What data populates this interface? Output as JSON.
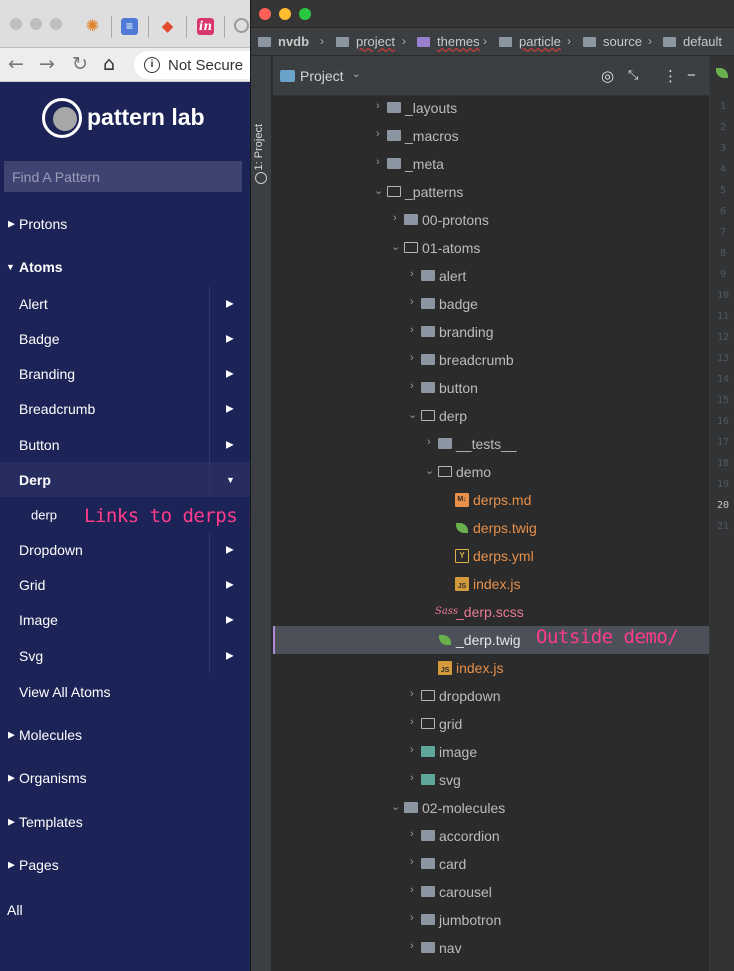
{
  "browser": {
    "address_text": "Not Secure",
    "logo_text": "pattern lab",
    "search_placeholder": "Find A Pattern",
    "nav": {
      "protons": "Protons",
      "atoms": "Atoms",
      "atoms_items": [
        "Alert",
        "Badge",
        "Branding",
        "Breadcrumb",
        "Button",
        "Derp",
        "derp",
        "Dropdown",
        "Grid",
        "Image",
        "Svg"
      ],
      "view_all": "View All Atoms",
      "molecules": "Molecules",
      "organisms": "Organisms",
      "templates": "Templates",
      "pages": "Pages",
      "all": "All"
    },
    "annotation_derp": "Links to derps page"
  },
  "ide": {
    "breadcrumbs": [
      "nvdb",
      "project",
      "themes",
      "particle",
      "source",
      "default"
    ],
    "side_tab": "1: Project",
    "project_title": "Project",
    "tree": [
      "_layouts",
      "_macros",
      "_meta",
      "_patterns",
      "00-protons",
      "01-atoms",
      "alert",
      "badge",
      "branding",
      "breadcrumb",
      "button",
      "derp",
      "__tests__",
      "demo",
      "derps.md",
      "derps.twig",
      "derps.yml",
      "index.js",
      "_derp.scss",
      "_derp.twig",
      "index.js",
      "dropdown",
      "grid",
      "image",
      "svg",
      "02-molecules",
      "accordion",
      "card",
      "carousel",
      "jumbotron",
      "nav"
    ],
    "annotation_outside": "Outside demo/",
    "line_numbers": [
      "1",
      "2",
      "3",
      "4",
      "5",
      "6",
      "7",
      "8",
      "9",
      "10",
      "11",
      "12",
      "13",
      "14",
      "15",
      "16",
      "17",
      "18",
      "19",
      "20",
      "21"
    ],
    "current_line": "20",
    "badges": {
      "md": "M↓",
      "yml": "Y",
      "js": "JS",
      "sass": "Sass"
    }
  },
  "colors": {
    "pl_navy": "#1c2356",
    "ide_bg": "#2b2b2b",
    "annotation_pink": "#ff3c8c",
    "twig_green": "#6ab04c",
    "scss_pink": "#e77a95",
    "js_orange": "#e8904a"
  }
}
